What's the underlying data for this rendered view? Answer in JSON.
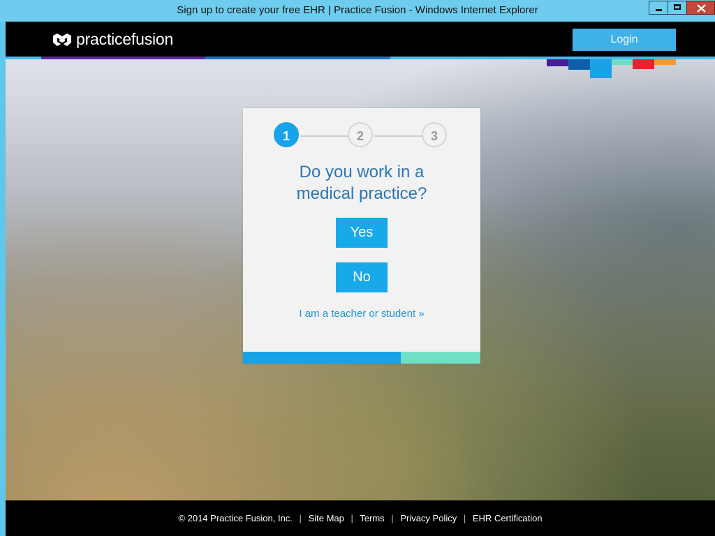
{
  "window": {
    "title": "Sign up to create your free EHR | Practice Fusion - Windows Internet Explorer"
  },
  "header": {
    "logo_text": "practicefusion",
    "login_label": "Login"
  },
  "card": {
    "steps": [
      "1",
      "2",
      "3"
    ],
    "active_step": 1,
    "question_line1": "Do you work in a",
    "question_line2": "medical practice?",
    "yes_label": "Yes",
    "no_label": "No",
    "teacher_link": "I am a teacher or student »"
  },
  "footer": {
    "copyright": "© 2014 Practice Fusion, Inc.",
    "links": [
      "Site Map",
      "Terms",
      "Privacy Policy",
      "EHR Certification"
    ]
  },
  "colors": {
    "accent": "#18a3e8",
    "question_text": "#2a75b8",
    "progress_remaining": "#6fe0c4",
    "brand_purple": "#5b2aa0",
    "brand_red": "#e8232a",
    "brand_orange": "#f79a2e"
  }
}
